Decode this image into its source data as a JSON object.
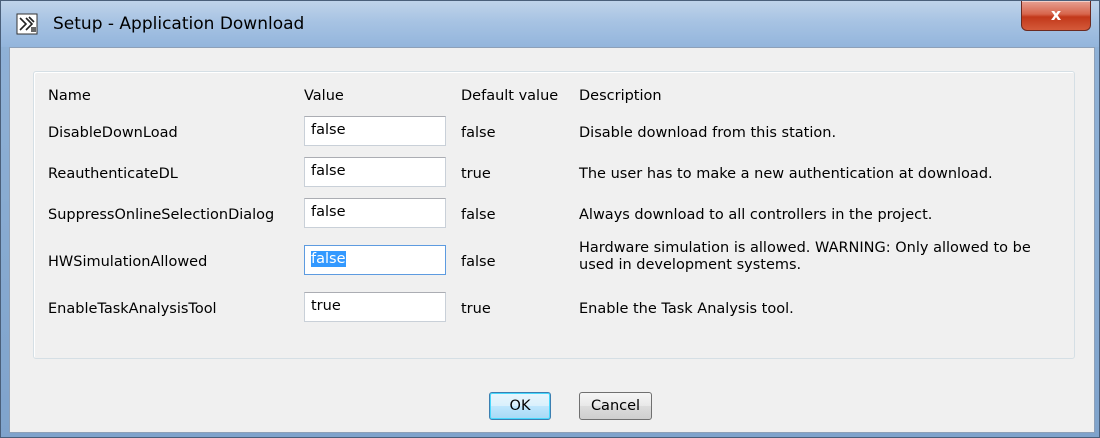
{
  "window": {
    "title": "Setup - Application Download",
    "close_label": "x"
  },
  "table": {
    "headers": {
      "name": "Name",
      "value": "Value",
      "default": "Default value",
      "description": "Description"
    },
    "rows": [
      {
        "name": "DisableDownLoad",
        "value": "false",
        "default": "false",
        "description": "Disable download from this station."
      },
      {
        "name": "ReauthenticateDL",
        "value": "false",
        "default": "true",
        "description": "The user has to make a new authentication at download."
      },
      {
        "name": "SuppressOnlineSelectionDialog",
        "value": "false",
        "default": "false",
        "description": "Always download to all controllers in the project."
      },
      {
        "name": "HWSimulationAllowed",
        "value": "false",
        "default": "false",
        "description": "Hardware simulation is allowed. WARNING: Only allowed to be used in development systems."
      },
      {
        "name": "EnableTaskAnalysisTool",
        "value": "true",
        "default": "true",
        "description": "Enable the Task Analysis tool."
      }
    ]
  },
  "buttons": {
    "ok": "OK",
    "cancel": "Cancel"
  }
}
